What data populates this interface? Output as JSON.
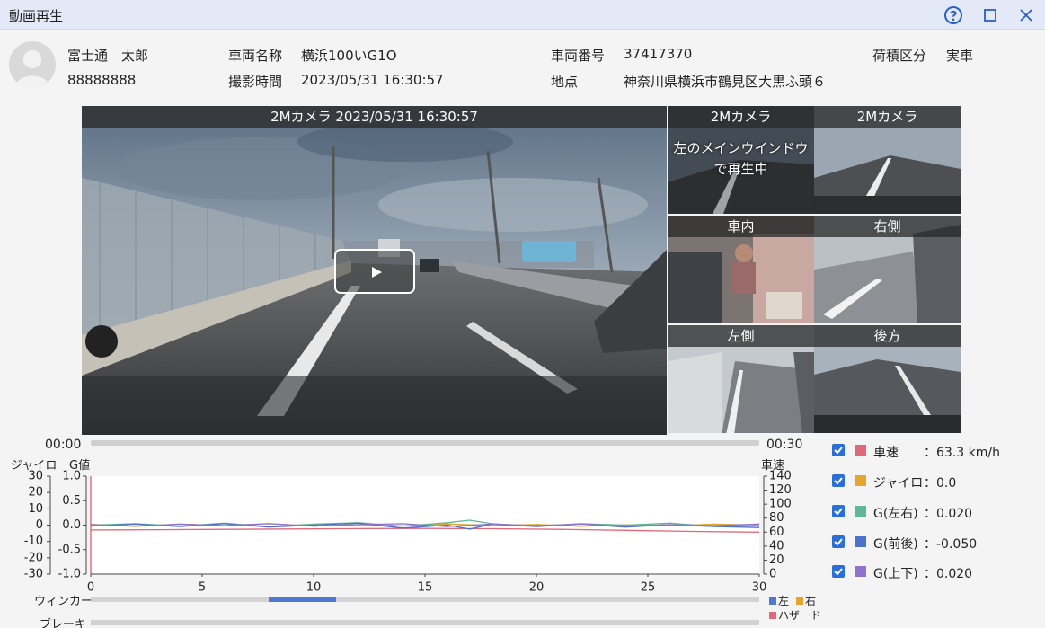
{
  "window": {
    "title": "動画再生",
    "icons": [
      "help-icon",
      "maximize-icon",
      "close-icon"
    ]
  },
  "driver": {
    "name": "富士通　太郎",
    "id": "88888888"
  },
  "vehicle": {
    "name_label": "車両名称",
    "name_value": "横浜100いG1O",
    "number_label": "車両番号",
    "number_value": "37417370",
    "load_label": "荷積区分",
    "load_value": "実車",
    "time_label": "撮影時間",
    "time_value": "2023/05/31 16:30:57",
    "place_label": "地点",
    "place_value": "神奈川県横浜市鶴見区大黒ふ頭６"
  },
  "main_video": {
    "caption": "2Mカメラ 2023/05/31 16:30:57"
  },
  "thumbs": [
    {
      "label": "2Mカメラ",
      "message": "左のメインウインドウで再生中"
    },
    {
      "label": "2Mカメラ"
    },
    {
      "label": "車内"
    },
    {
      "label": "右側"
    },
    {
      "label": "左側"
    },
    {
      "label": "後方"
    }
  ],
  "timeline": {
    "start": "00:00",
    "end": "00:30"
  },
  "chart_data": {
    "type": "line",
    "axis_titles": {
      "gyro": "ジャイロ",
      "g": "G値",
      "speed": "車速"
    },
    "gyro_ticks": [
      "30",
      "20",
      "10",
      "0",
      "-10",
      "-20",
      "-30"
    ],
    "g_ticks": [
      "1.0",
      "0.5",
      "0.0",
      "-0.5",
      "-1.0"
    ],
    "speed_ticks": [
      "140",
      "120",
      "100",
      "80",
      "60",
      "40",
      "20",
      "0"
    ],
    "x_ticks": [
      "0",
      "5",
      "10",
      "15",
      "20",
      "25",
      "30"
    ],
    "xlim": [
      0,
      30
    ],
    "ylim_gyro": [
      -30,
      30
    ],
    "ylim_g": [
      -1.0,
      1.0
    ],
    "ylim_speed": [
      0,
      140
    ],
    "series": [
      {
        "name": "車速",
        "color": "#e0687a",
        "axis": "speed",
        "x": [
          0,
          3,
          6,
          9,
          12,
          15,
          18,
          21,
          24,
          27,
          30
        ],
        "values": [
          63.0,
          63.5,
          64.0,
          64.5,
          65.0,
          65.3,
          64.8,
          64.0,
          62.5,
          61.0,
          60.0
        ]
      },
      {
        "name": "ジャイロ",
        "color": "#e3a72f",
        "axis": "gyro",
        "x": [
          0,
          2,
          4,
          6,
          8,
          10,
          12,
          14,
          16,
          18,
          20,
          22,
          24,
          26,
          28,
          30
        ],
        "values": [
          0.5,
          -0.8,
          0.6,
          -0.4,
          0.9,
          -0.6,
          0.3,
          -0.5,
          0.7,
          -0.3,
          0.4,
          -0.7,
          0.2,
          -0.4,
          0.6,
          0.0
        ]
      },
      {
        "name": "G(左右)",
        "color": "#5fb794",
        "axis": "g",
        "x": [
          0,
          2,
          4,
          6,
          8,
          10,
          12,
          14,
          16,
          17,
          18,
          20,
          22,
          24,
          26,
          28,
          30
        ],
        "values": [
          0.0,
          0.03,
          -0.02,
          0.04,
          -0.03,
          0.02,
          0.05,
          -0.02,
          0.05,
          0.1,
          0.03,
          -0.02,
          0.03,
          0.0,
          0.04,
          -0.03,
          0.02
        ]
      },
      {
        "name": "G(前後)",
        "color": "#4e72c9",
        "axis": "g",
        "x": [
          0,
          2,
          4,
          6,
          8,
          10,
          12,
          14,
          16,
          17,
          18,
          20,
          22,
          24,
          26,
          28,
          30
        ],
        "values": [
          -0.02,
          0.02,
          -0.03,
          0.03,
          -0.04,
          0.0,
          0.04,
          -0.06,
          0.0,
          -0.08,
          0.02,
          -0.03,
          0.02,
          -0.04,
          0.01,
          -0.03,
          -0.05
        ]
      },
      {
        "name": "G(上下)",
        "color": "#8e72c9",
        "axis": "g",
        "x": [
          0,
          2,
          4,
          6,
          8,
          10,
          12,
          14,
          16,
          18,
          20,
          22,
          24,
          26,
          28,
          30
        ],
        "values": [
          0.01,
          -0.02,
          0.02,
          -0.01,
          0.03,
          -0.02,
          0.01,
          0.03,
          -0.03,
          0.02,
          -0.01,
          0.02,
          -0.02,
          0.01,
          -0.01,
          0.02
        ]
      }
    ]
  },
  "legend": [
    {
      "name": "車速",
      "color": "#e0687a",
      "value": "：63.3 km/h",
      "checked": true
    },
    {
      "name": "ジャイロ",
      "color": "#e3a72f",
      "value": "：0.0",
      "checked": true
    },
    {
      "name": "G(左右)",
      "color": "#5fb794",
      "value": "：0.020",
      "checked": true
    },
    {
      "name": "G(前後)",
      "color": "#4e72c9",
      "value": "：-0.050",
      "checked": true
    },
    {
      "name": "G(上下)",
      "color": "#8e72c9",
      "value": "：0.020",
      "checked": true
    }
  ],
  "tracks": {
    "blinker_label": "ウィンカー",
    "brake_label": "ブレーキ",
    "blinker_left_range": [
      8,
      11
    ],
    "legend_left": "左",
    "legend_right": "右",
    "legend_hazard": "ハザード",
    "colors": {
      "left": "#4f79d0",
      "right": "#e3a72f",
      "hazard": "#e0687a"
    }
  }
}
